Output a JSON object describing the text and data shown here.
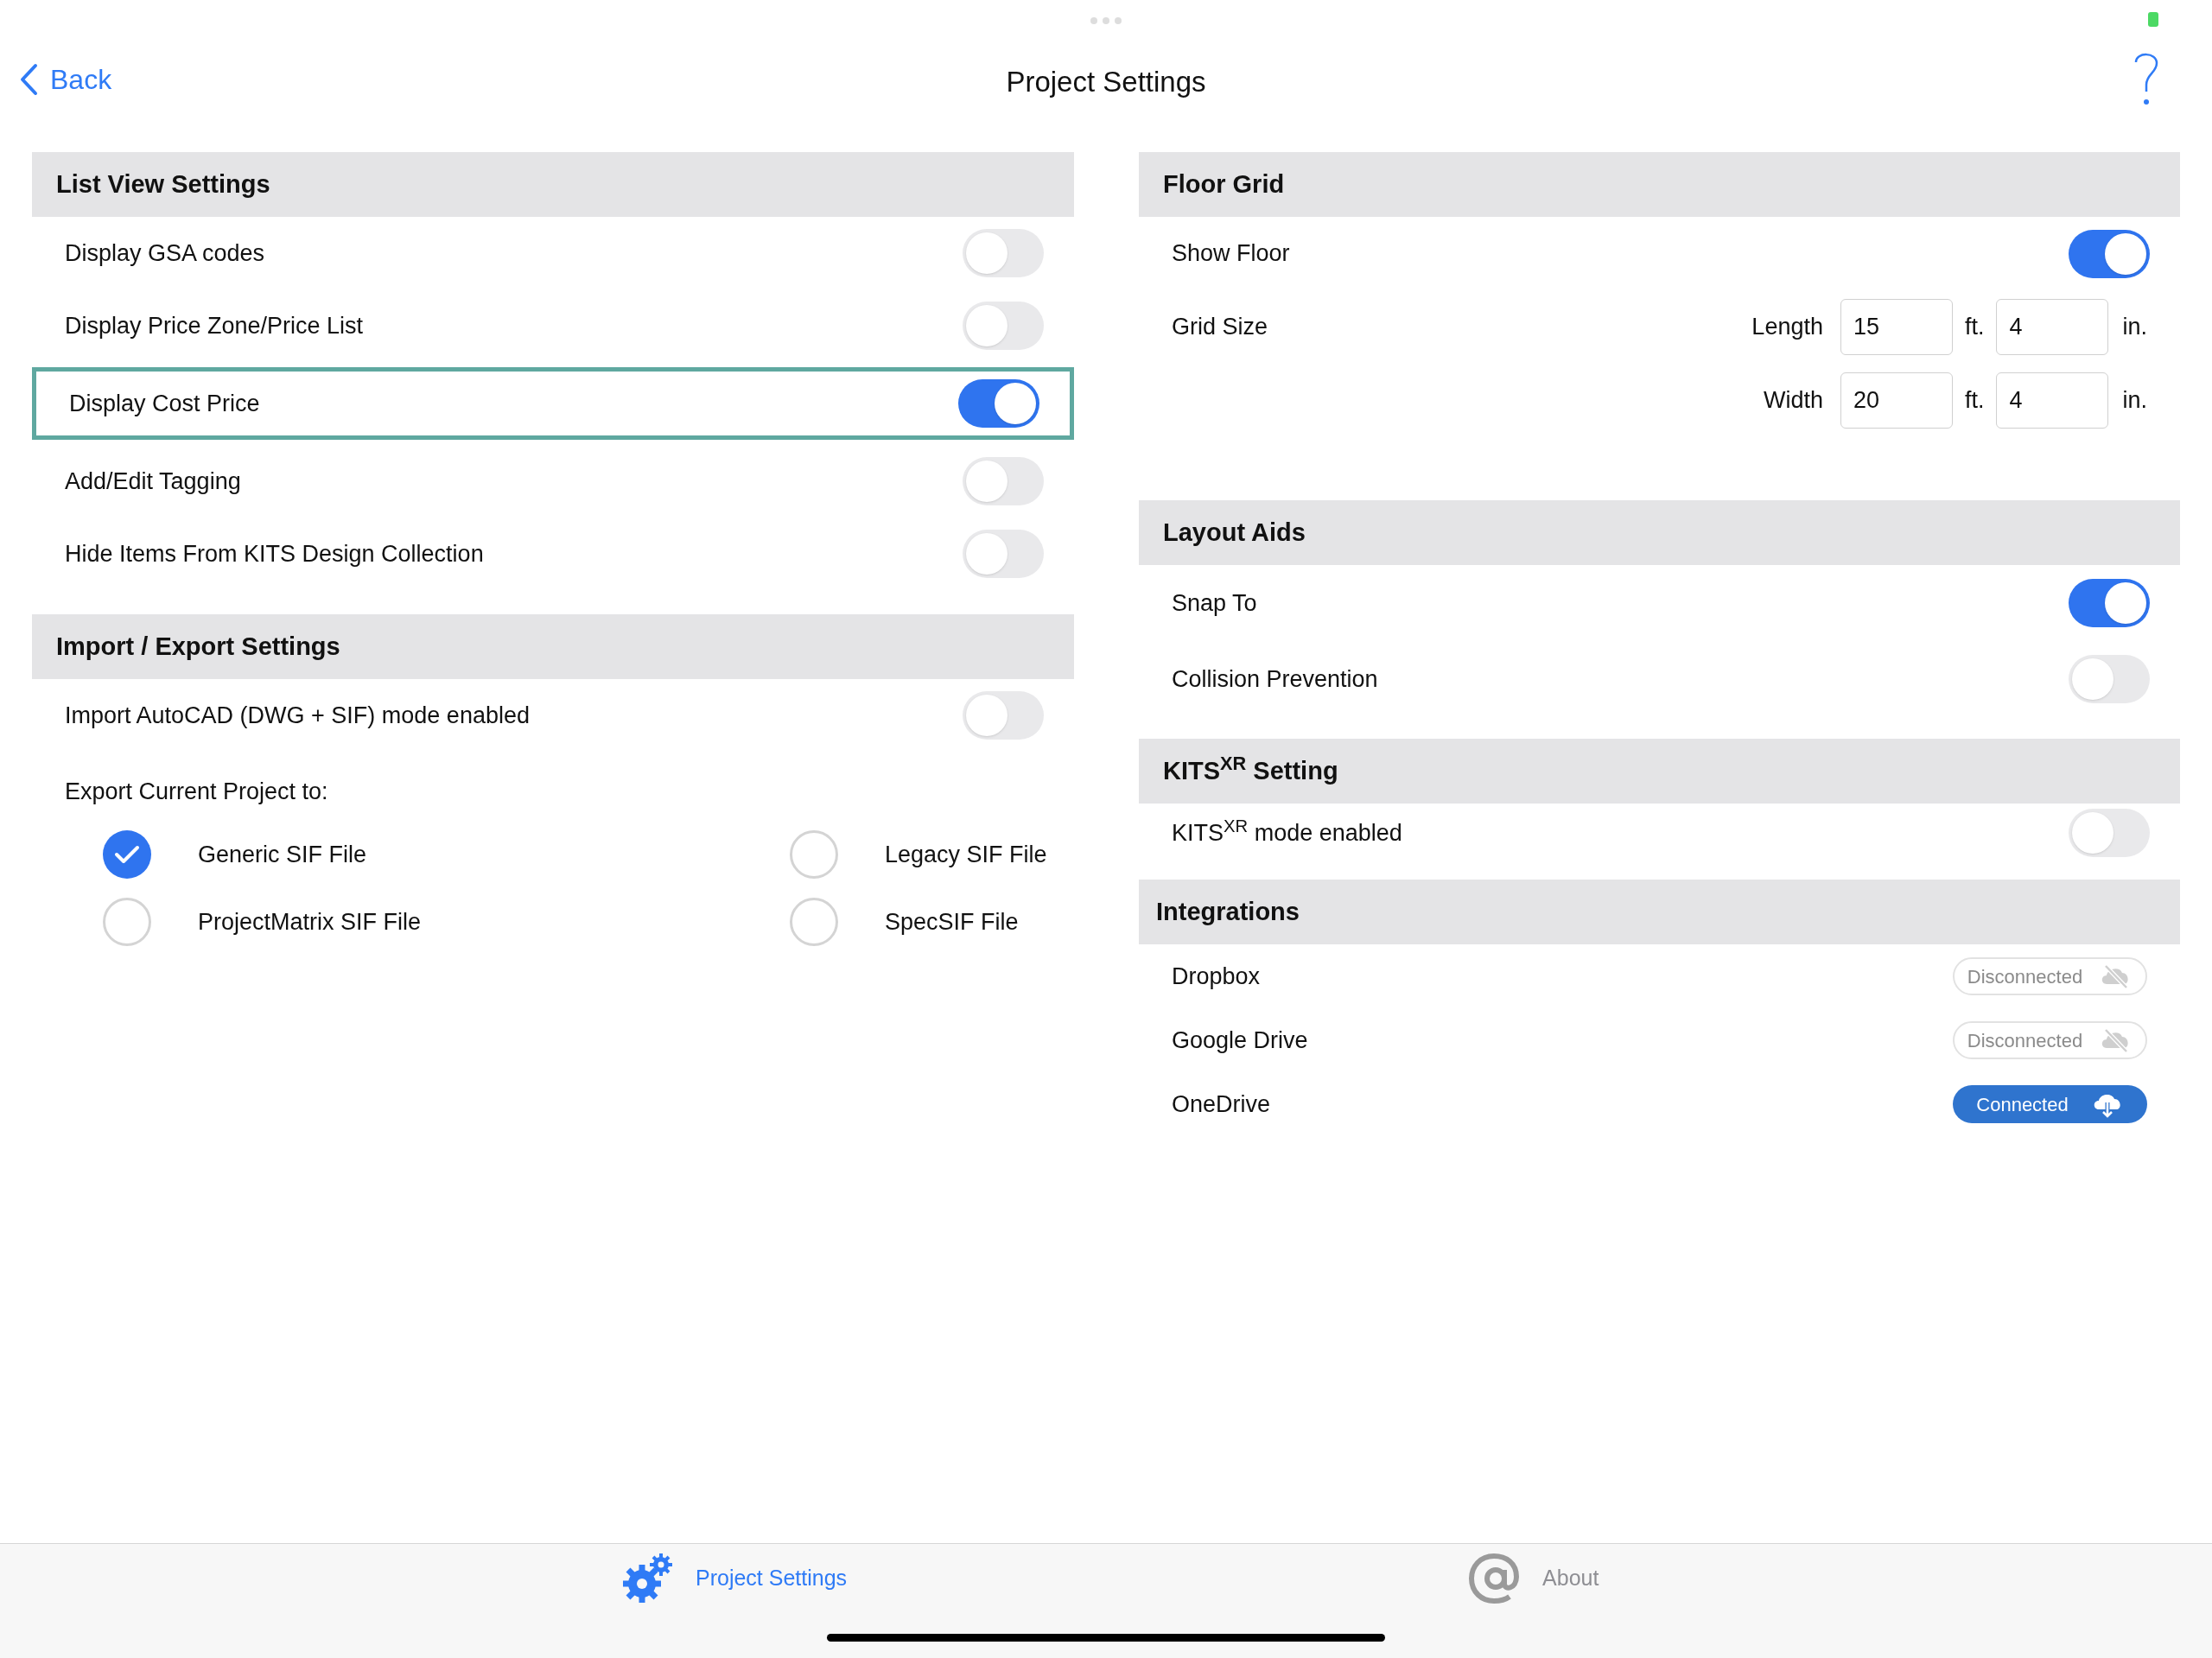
{
  "nav": {
    "back": "Back",
    "title": "Project Settings"
  },
  "left_sections": [
    {
      "title": "List View Settings",
      "rows": [
        {
          "kind": "toggle",
          "label": "Display GSA codes",
          "on": false,
          "focused": false
        },
        {
          "kind": "toggle",
          "label": "Display Price Zone/Price List",
          "on": false,
          "focused": false
        },
        {
          "kind": "toggle",
          "label": "Display Cost Price",
          "on": true,
          "focused": true
        },
        {
          "kind": "toggle",
          "label": "Add/Edit Tagging",
          "on": false,
          "focused": false
        },
        {
          "kind": "toggle",
          "label": "Hide Items From KITS Design Collection",
          "on": false,
          "focused": false
        }
      ]
    },
    {
      "title": "Import / Export Settings",
      "rows": [
        {
          "kind": "toggle",
          "label": "Import AutoCAD (DWG + SIF) mode enabled",
          "on": false,
          "focused": false
        },
        {
          "kind": "caption",
          "label": "Export Current Project to:"
        },
        {
          "kind": "radios",
          "options": [
            {
              "label": "Generic SIF File",
              "selected": true
            },
            {
              "label": "Legacy SIF File",
              "selected": false
            },
            {
              "label": "ProjectMatrix SIF File",
              "selected": false
            },
            {
              "label": "SpecSIF File",
              "selected": false
            }
          ]
        }
      ]
    }
  ],
  "right_sections": [
    {
      "title": "Floor Grid",
      "rows": [
        {
          "kind": "toggle",
          "label": "Show Floor",
          "on": true
        },
        {
          "kind": "dimension",
          "label": "Grid Size",
          "field_label": "Length",
          "feet": "15",
          "feet_unit": "ft.",
          "inches": "4",
          "inch_unit": "in."
        },
        {
          "kind": "dimension",
          "field_label": "Width",
          "feet": "20",
          "feet_unit": "ft.",
          "inches": "4",
          "inch_unit": "in."
        }
      ]
    },
    {
      "title": "Layout Aids",
      "rows": [
        {
          "kind": "toggle",
          "label": "Snap To",
          "on": true
        },
        {
          "kind": "toggle",
          "label": "Collision Prevention",
          "on": false
        }
      ]
    },
    {
      "title": "KITS$^{XR}$ Setting",
      "rows": [
        {
          "kind": "toggle",
          "label": "KITS$^{XR}$ mode enabled",
          "on": false
        }
      ]
    },
    {
      "title": "Integrations",
      "rows": [
        {
          "kind": "integration",
          "label": "Dropbox",
          "status": "Disconnected",
          "connected": false
        },
        {
          "kind": "integration",
          "label": "Google Drive",
          "status": "Disconnected",
          "connected": false
        },
        {
          "kind": "integration",
          "label": "OneDrive",
          "status": "Connected",
          "connected": true
        }
      ]
    }
  ],
  "tabs": [
    {
      "label": "Project Settings",
      "selected": true
    },
    {
      "label": "About",
      "selected": false
    }
  ]
}
